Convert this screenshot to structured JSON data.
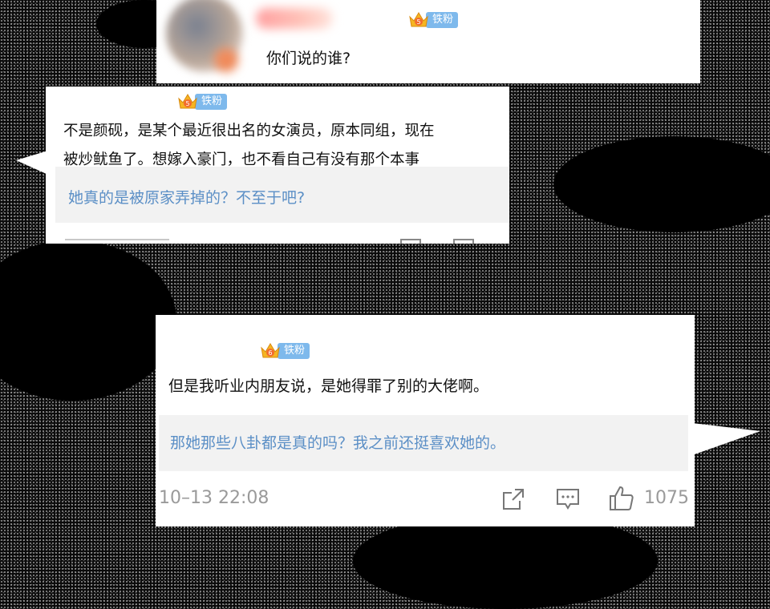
{
  "comments": [
    {
      "badge": "铁粉",
      "text": "你们说的谁?"
    },
    {
      "badge": "铁粉",
      "lines": [
        "不是颜砚，是某个最近很出名的女演员，原本同组，现在",
        "被炒鱿鱼了。想嫁入豪门，也不看自己有没有那个本事"
      ],
      "reply": "她真的是被原家弄掉的？不至于吧?"
    },
    {
      "badge": "铁粉",
      "text": "但是我听业内朋友说，是她得罪了别的大佬啊。",
      "reply": "那她那些八卦都是真的吗？我之前还挺喜欢她的。",
      "timestamp": "10–13 22:08",
      "likes": "1075"
    }
  ],
  "colors": {
    "badge": "#7eb9ec",
    "reply": "#5b8fc6",
    "meta": "#9a9a9a"
  }
}
